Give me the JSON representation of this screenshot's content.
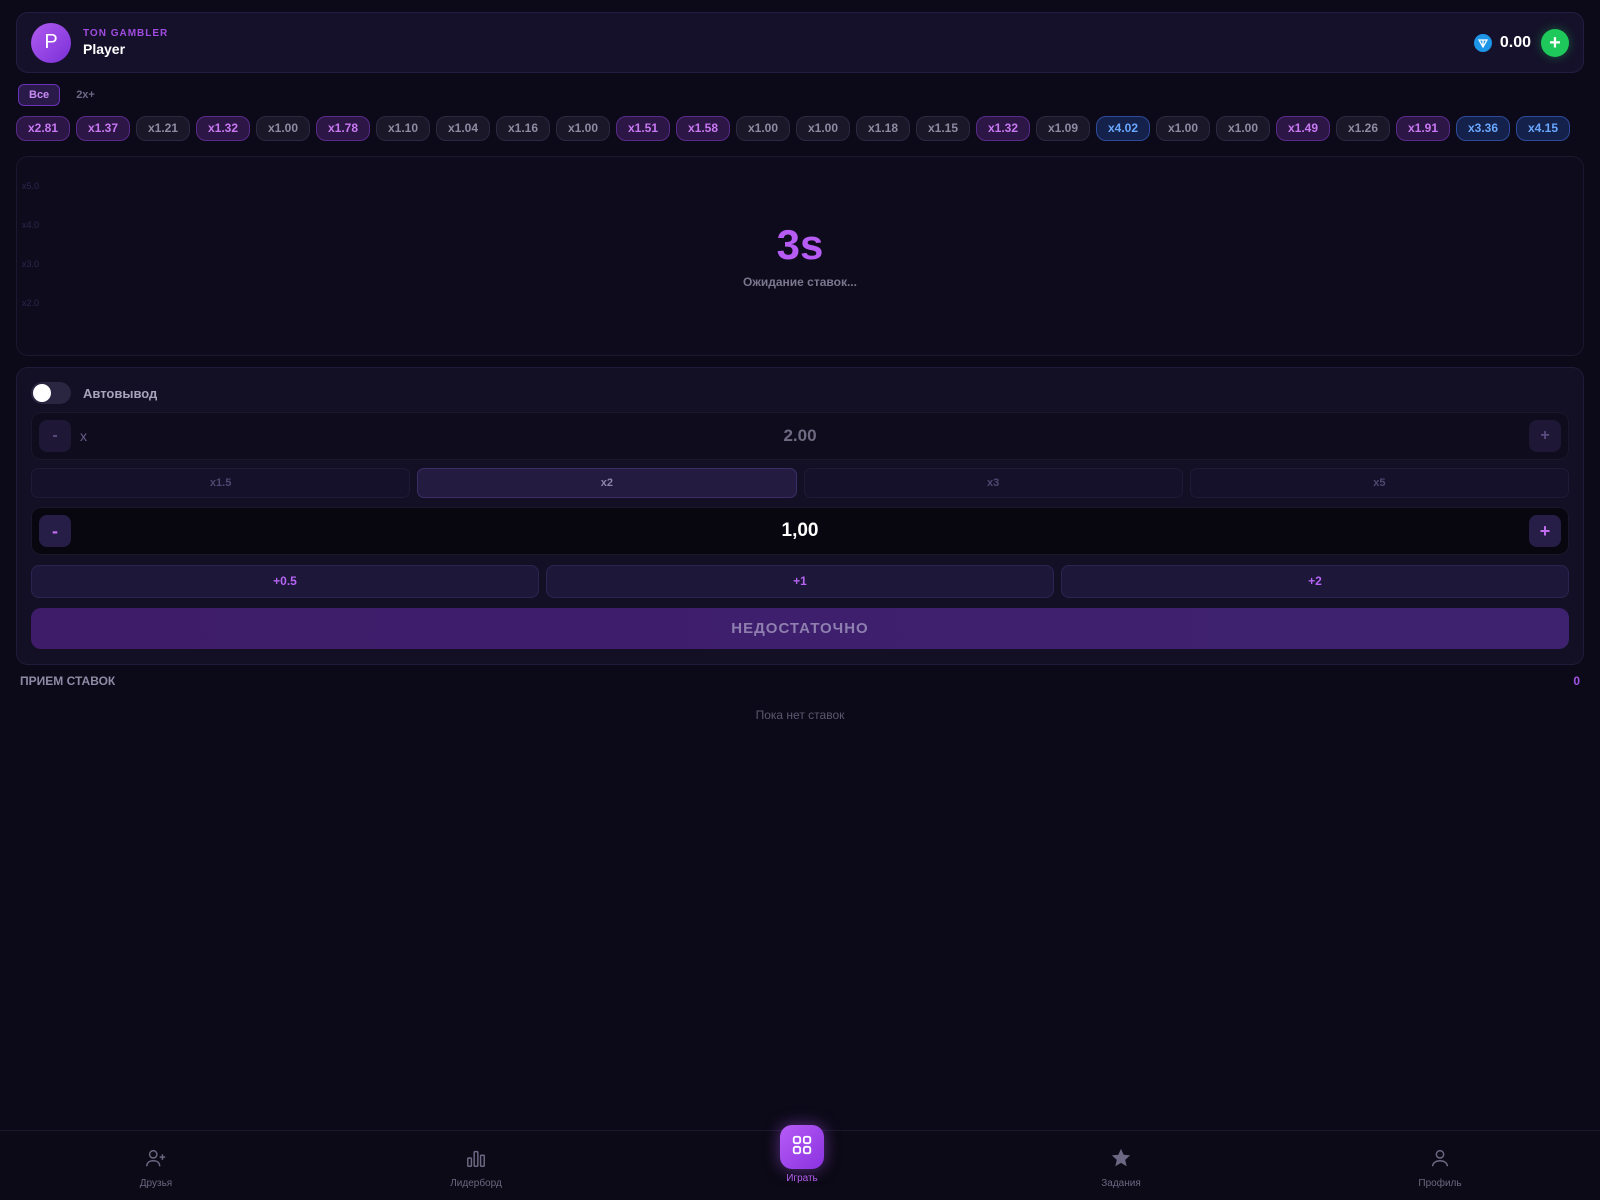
{
  "header": {
    "avatar_letter": "P",
    "brand": "TON GAMBLER",
    "username": "Player",
    "balance": "0.00",
    "add_label": "+"
  },
  "filters": [
    {
      "label": "Все",
      "active": true
    },
    {
      "label": "2x+",
      "active": false
    }
  ],
  "history": [
    {
      "label": "x2.81",
      "tone": "purple"
    },
    {
      "label": "x1.37",
      "tone": "purple"
    },
    {
      "label": "x1.21",
      "tone": "gray"
    },
    {
      "label": "x1.32",
      "tone": "purple"
    },
    {
      "label": "x1.00",
      "tone": "gray"
    },
    {
      "label": "x1.78",
      "tone": "purple"
    },
    {
      "label": "x1.10",
      "tone": "gray"
    },
    {
      "label": "x1.04",
      "tone": "gray"
    },
    {
      "label": "x1.16",
      "tone": "gray"
    },
    {
      "label": "x1.00",
      "tone": "gray"
    },
    {
      "label": "x1.51",
      "tone": "purple"
    },
    {
      "label": "x1.58",
      "tone": "purple"
    },
    {
      "label": "x1.00",
      "tone": "gray"
    },
    {
      "label": "x1.00",
      "tone": "gray"
    },
    {
      "label": "x1.18",
      "tone": "gray"
    },
    {
      "label": "x1.15",
      "tone": "gray"
    },
    {
      "label": "x1.32",
      "tone": "purple"
    },
    {
      "label": "x1.09",
      "tone": "gray"
    },
    {
      "label": "x4.02",
      "tone": "blue"
    },
    {
      "label": "x1.00",
      "tone": "gray"
    },
    {
      "label": "x1.00",
      "tone": "gray"
    },
    {
      "label": "x1.49",
      "tone": "purple"
    },
    {
      "label": "x1.26",
      "tone": "gray"
    },
    {
      "label": "x1.91",
      "tone": "purple"
    },
    {
      "label": "x3.36",
      "tone": "blue"
    },
    {
      "label": "x4.15",
      "tone": "blue"
    }
  ],
  "game": {
    "axis_labels": [
      "x5.0",
      "x4.0",
      "x3.0",
      "x2.0"
    ],
    "countdown": "3s",
    "status": "Ожидание ставок..."
  },
  "bet": {
    "autocashout_label": "Автовывод",
    "autocashout_enabled": false,
    "auto_prefix": "x",
    "auto_value": "2.00",
    "auto_minus": "-",
    "auto_plus": "+",
    "multipliers": [
      {
        "label": "x1.5",
        "selected": false
      },
      {
        "label": "x2",
        "selected": true
      },
      {
        "label": "x3",
        "selected": false
      },
      {
        "label": "x5",
        "selected": false
      }
    ],
    "amount_minus": "-",
    "amount": "1,00",
    "amount_plus": "+",
    "quick_adds": [
      "+0.5",
      "+1",
      "+2"
    ],
    "main_button": "НЕДОСТАТОЧНО"
  },
  "bets_list": {
    "title": "ПРИЕМ СТАВОК",
    "count": "0",
    "empty": "Пока нет ставок"
  },
  "nav": [
    {
      "label": "Друзья",
      "icon": "add-user-icon",
      "active": false
    },
    {
      "label": "Лидерборд",
      "icon": "bar-chart-icon",
      "active": false
    },
    {
      "label": "Играть",
      "icon": "grid-icon",
      "active": true
    },
    {
      "label": "Задания",
      "icon": "star-icon",
      "active": false
    },
    {
      "label": "Профиль",
      "icon": "user-icon",
      "active": false
    }
  ],
  "colors": {
    "background": "#0c0a18",
    "accent": "#b65cf4",
    "add_button": "#1ec85a",
    "ton": "#1e96e8"
  }
}
